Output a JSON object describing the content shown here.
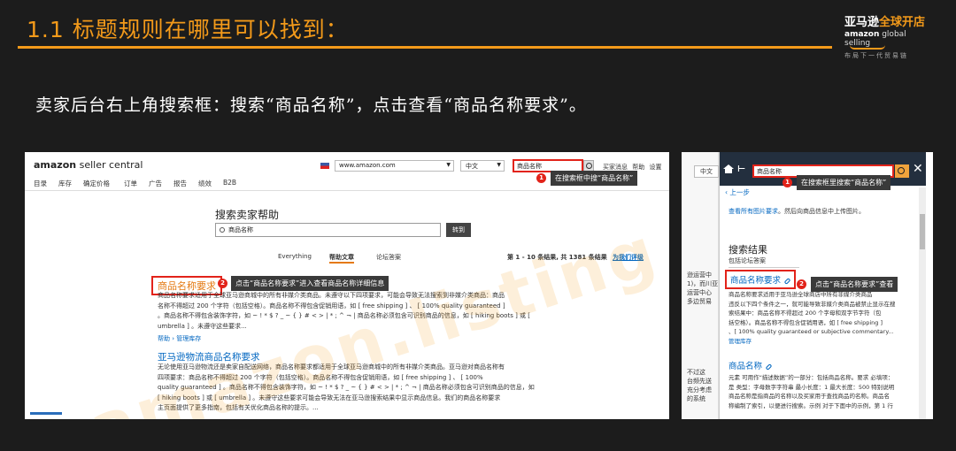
{
  "slide": {
    "title": "1.1 标题规则在哪里可以找到：",
    "brand_line1_a": "亚马逊",
    "brand_line1_b": "全球开店",
    "brand_line2_a": "amazon",
    "brand_line2_b": " global selling",
    "brand_slogan": "布局下一代贸易链",
    "instruction": "卖家后台右上角搜索框：搜索“商品名称”，点击查看“商品名称要求”。"
  },
  "left_shot": {
    "logo_a": "amazon",
    "logo_b": " seller central",
    "marketplace": "www.amazon.com",
    "language": "中文",
    "search_value": "商品名称",
    "toplinks": [
      "买家消息",
      "帮助",
      "设置"
    ],
    "nav": [
      "目录",
      "库存",
      "确定价格",
      "订单",
      "广告",
      "报告",
      "绩效",
      "B2B"
    ],
    "callout1_badge": "1",
    "callout1": "在搜索框中搜“商品名称”",
    "help_title": "搜索卖家帮助",
    "help_search_value": "商品名称",
    "help_go": "转到",
    "tabs": [
      "Everything",
      "帮助文章",
      "论坛答案"
    ],
    "results_count": "第 1 - 10 条结果, 共 1381 条结果",
    "feedback": "为我们评级",
    "result1_title": "商品名称要求",
    "callout2_badge": "2",
    "callout2": "点击“商品名称要求”进入查看商品名称详细信息",
    "result1_lines": [
      "商品名称要求适用于全球亚马逊商城中的所有非媒介类商品。未遵守以下四项要求，可能会导致无法搜索到非媒介类商品：商品",
      "名称不得超过 200 个字符（包括空格）。商品名称不得包含促销用语，如 [ free shipping ] 、 [ 100% quality guaranteed ]",
      "。商品名称不得包含装饰字符，如 ~ ! * $ ? _ ~ { } # < > | * ; ^ ¬ | 商品名称必须包含可识别商品的信息，如 [ hiking boots ] 或 [",
      "umbrella ] 。未遵守这些要求..."
    ],
    "result1_breadcrumb": "帮助 › 管理库存",
    "result2_title": "亚马逊物流商品名称要求",
    "result2_lines": [
      "无论使用亚马逊物流还是卖家自配送网络，商品名称要求都适用于全球亚马逊商城中的所有非媒介类商品。亚马逊对商品名称有",
      "四项要求：商品名称不得超过 200 个字符（包括空格）。商品名称不得包含促销用语，如 [ free shipping ] 、 [ 100%",
      "quality guaranteed ] 。商品名称不得包含装饰字符，如 ~ ! * $ ? _ ~ { } # < > | * ; ^ ¬ | 商品名称必须包含可识别商品的信息，如",
      "[ hiking boots ] 或 [ umbrella ] 。未遵守这些要求可能会导致无法在亚马逊搜索结果中显示商品信息。我们的商品名称要求",
      "主页面提供了更多指南，包括有关优化商品名称的提示。..."
    ],
    "watermark": "amazon.listing"
  },
  "right_shot": {
    "lang": "中文",
    "search_value": "商品名称",
    "callout1_badge": "1",
    "callout1": "在搜索框里搜索“商品名称”",
    "back": "‹ 上一步",
    "link_line_a": "查看所有图片要求",
    "link_line_b": "。然后向商品信息中上传图片。",
    "results_title": "搜索结果",
    "tab": "包括论坛答案",
    "result1_title": "商品名称要求",
    "callout2_badge": "2",
    "callout2": "点击“商品名称要求”查看",
    "result1_lines": [
      "商品名称要求适用于亚马逊全球商店中所有非媒介类商品",
      "违反以下四个条件之一，就可能导致非媒介类商品被禁止显示在搜",
      "索结果中：商品名称不得超过 200 个字母和双字节字符（包",
      "括空格）。商品名称不得包含促销用语，如 [ free shipping ]",
      "、[ 100% quality guaranteed or subjective commentary...",
      "管理库存"
    ],
    "result2_title": "商品名称",
    "result2_lines": [
      "元素 可用作“描述数据”的一部分：包括商品名称。要求 必填项：",
      "是 类型：字母数字字符串 最小长度：1 最大长度：500 特别说明",
      "商品名称是指商品的名称以及买家用于查找商品的名称。商品名",
      "称编制了索引，以便进行搜索。示例 对于下面中的示例，第 1 行"
    ],
    "left_strip_lines": [
      "逊运营中",
      "1)，而川亚",
      "运营中心",
      "多边贸易",
      "不过这",
      "台频先送",
      "充分考虑",
      "的系统"
    ]
  }
}
